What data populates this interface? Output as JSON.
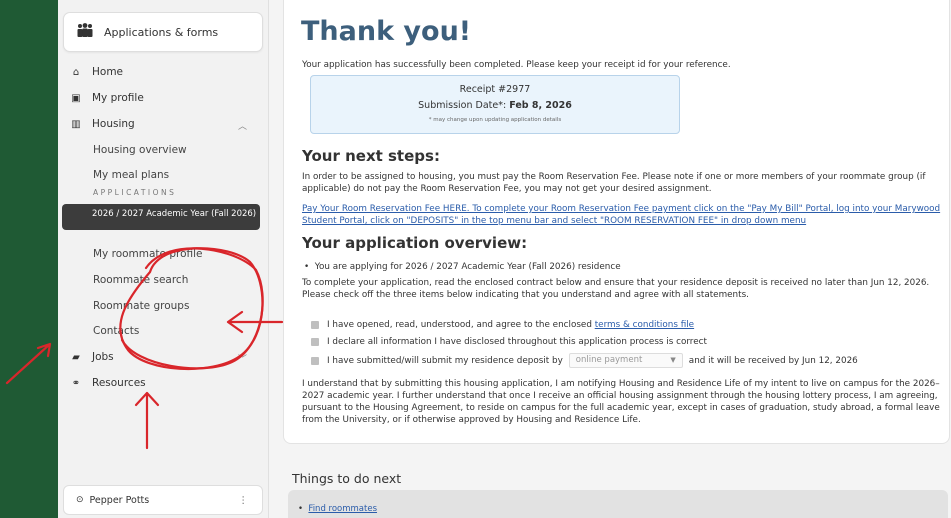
{
  "sidebar": {
    "app_title": "Applications & forms",
    "nav": {
      "home": "Home",
      "my_profile": "My profile",
      "housing": "Housing",
      "housing_overview": "Housing overview",
      "my_meal_plans": "My meal plans",
      "applications_section": "APPLICATIONS",
      "active_application": "2026 / 2027 Academic Year (Fall 2026)",
      "my_roommate_profile": "My roommate profile",
      "roommate_search": "Roommate search",
      "roommate_groups": "Roommate groups",
      "contacts": "Contacts",
      "jobs": "Jobs",
      "resources": "Resources"
    },
    "user_name": "Pepper Potts"
  },
  "main": {
    "title": "Thank you!",
    "success_text": "Your application has successfully been completed. Please keep your receipt id for your reference.",
    "receipt": {
      "receipt_label": "Receipt #2977",
      "submission_prefix": "Submission Date*:",
      "submission_date": "Feb 8, 2026",
      "note": "* may change upon updating application details"
    },
    "next_steps_heading": "Your next steps:",
    "next_steps_text": "In order to be assigned to housing, you must pay the Room Reservation Fee. Please note if one or more members of your roommate group (if applicable) do not pay the Room Reservation Fee, you may not get your desired assignment.",
    "payment_link_line1": "Pay Your Room Reservation Fee HERE. To complete your Room Reservation Fee payment click on the \"Pay My Bill\" Portal, log into your Marywood",
    "payment_link_line2": "Student Portal, click on \"DEPOSITS\" in the top menu bar and select \"ROOM RESERVATION FEE\" in drop down menu",
    "overview_heading": "Your application overview:",
    "overview_bullet": "You are applying for 2026 / 2027 Academic Year (Fall 2026) residence",
    "overview_text": "To complete your application, read the enclosed contract below and ensure that your residence deposit is received no later than Jun 12, 2026. Please check off the three items below indicating that you understand and agree with all statements.",
    "check1_text": "I have opened, read, understood, and agree to the enclosed",
    "check1_link": "terms & conditions file",
    "check2_text": "I declare all information I have disclosed throughout this application process is correct",
    "check3_prefix": "I have submitted/will submit my residence deposit by",
    "check3_select": "online payment",
    "check3_suffix": "and it will be received by Jun 12, 2026",
    "agreement_text": "I understand that by submitting this housing application, I am notifying Housing and Residence Life of my intent to live on campus for the 2026–2027 academic year. I further understand that once I receive an official housing assignment through the housing lottery process, I am agreeing, pursuant to the Housing Agreement, to reside on campus for the full academic year, except in cases of graduation, study abroad, a formal leave from the University, or if otherwise approved by Housing and Residence Life."
  },
  "things": {
    "heading": "Things to do next",
    "item1": "Find roommates"
  },
  "colors": {
    "background_green": "#1f5a34",
    "title_blue": "#3d5f7c",
    "annotation_red": "#d9262b",
    "receipt_bg": "#eaf4fc"
  }
}
